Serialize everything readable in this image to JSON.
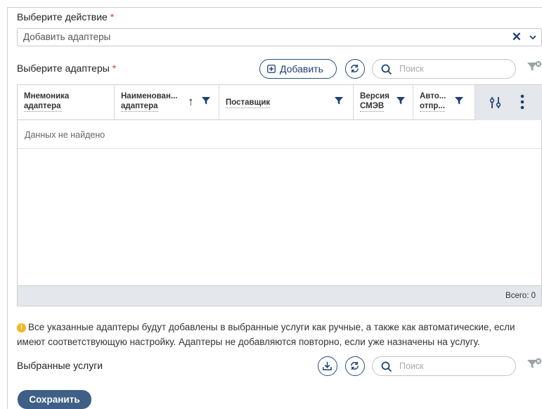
{
  "action": {
    "label": "Выберите действие",
    "required_mark": "*",
    "value": "Добавить адаптеры"
  },
  "adapters": {
    "label": "Выберите адаптеры",
    "required_mark": "*",
    "add_label": "Добавить",
    "search_placeholder": "Поиск"
  },
  "table": {
    "columns": [
      {
        "line1": "Мнемоника",
        "line2": "адаптера"
      },
      {
        "line1": "Наименован...",
        "line2": "адаптера"
      },
      {
        "line1": "Поставщик",
        "line2": ""
      },
      {
        "line1": "Версия",
        "line2": "СМЭВ"
      },
      {
        "line1": "Авто...",
        "line2": "отпр..."
      }
    ],
    "sort_arrow": "↑",
    "empty_text": "Данных не найдено",
    "total": "Всего: 0"
  },
  "info": {
    "text": "Все указанные адаптеры будут добавлены в выбранные услуги как ручные, а также как автоматические, если имеют соответствующую настройку. Адаптеры не добавляются повторно, если уже назначены на услугу."
  },
  "services": {
    "label": "Выбранные услуги",
    "search_placeholder": "Поиск"
  },
  "save_label": "Сохранить"
}
